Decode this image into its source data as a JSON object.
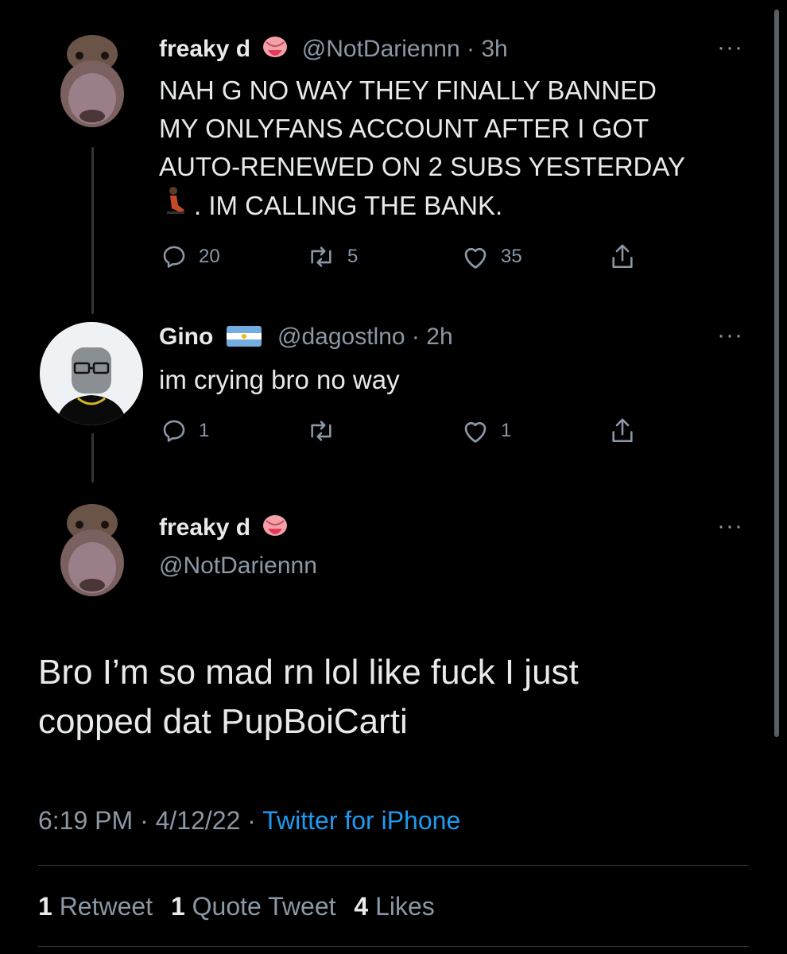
{
  "tweet1": {
    "display_name": "freaky d",
    "name_emoji": "tongue-emoji",
    "handle": "@NotDariennn",
    "time": "3h",
    "text_lines": [
      "NAH G NO WAY THEY FINALLY BANNED",
      "MY ONLYFANS ACCOUNT AFTER I GOT",
      "AUTO-RENEWED ON 2 SUBS YESTERDAY",
      ". IM CALLING THE BANK."
    ],
    "replies": "20",
    "retweets": "5",
    "likes": "35"
  },
  "tweet2": {
    "display_name": "Gino",
    "name_emoji": "argentina-flag",
    "handle": "@dagostlno",
    "time": "2h",
    "text": "im crying bro no way",
    "replies": "1",
    "retweets": "",
    "likes": "1"
  },
  "main": {
    "display_name": "freaky d",
    "handle": "@NotDariennn",
    "text_lines": [
      "Bro I’m so mad rn lol like fuck I just",
      "copped dat PupBoiCarti"
    ],
    "time": "6:19 PM",
    "date": "4/12/22",
    "source": "Twitter for iPhone",
    "retweet_count": "1",
    "retweet_label": "Retweet",
    "quote_count": "1",
    "quote_label": "Quote Tweet",
    "like_count": "4",
    "like_label": "Likes"
  },
  "separator": "·",
  "colors": {
    "link": "#1d9bf0",
    "muted": "#8b98a5",
    "text": "#e7e9ea",
    "bg": "#000000"
  }
}
